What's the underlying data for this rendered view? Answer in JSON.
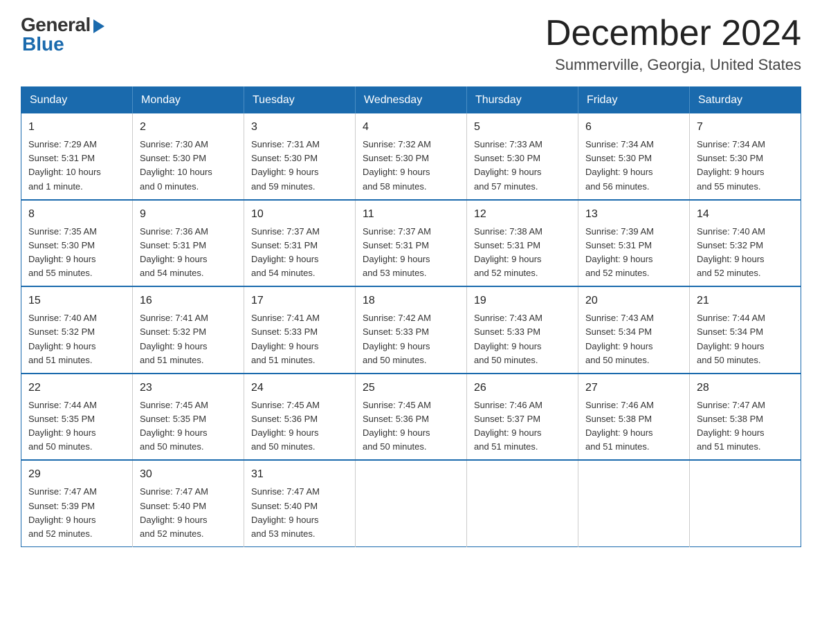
{
  "logo": {
    "general": "General",
    "blue": "Blue"
  },
  "title": "December 2024",
  "location": "Summerville, Georgia, United States",
  "days_of_week": [
    "Sunday",
    "Monday",
    "Tuesday",
    "Wednesday",
    "Thursday",
    "Friday",
    "Saturday"
  ],
  "weeks": [
    [
      {
        "day": "1",
        "info": "Sunrise: 7:29 AM\nSunset: 5:31 PM\nDaylight: 10 hours\nand 1 minute."
      },
      {
        "day": "2",
        "info": "Sunrise: 7:30 AM\nSunset: 5:30 PM\nDaylight: 10 hours\nand 0 minutes."
      },
      {
        "day": "3",
        "info": "Sunrise: 7:31 AM\nSunset: 5:30 PM\nDaylight: 9 hours\nand 59 minutes."
      },
      {
        "day": "4",
        "info": "Sunrise: 7:32 AM\nSunset: 5:30 PM\nDaylight: 9 hours\nand 58 minutes."
      },
      {
        "day": "5",
        "info": "Sunrise: 7:33 AM\nSunset: 5:30 PM\nDaylight: 9 hours\nand 57 minutes."
      },
      {
        "day": "6",
        "info": "Sunrise: 7:34 AM\nSunset: 5:30 PM\nDaylight: 9 hours\nand 56 minutes."
      },
      {
        "day": "7",
        "info": "Sunrise: 7:34 AM\nSunset: 5:30 PM\nDaylight: 9 hours\nand 55 minutes."
      }
    ],
    [
      {
        "day": "8",
        "info": "Sunrise: 7:35 AM\nSunset: 5:30 PM\nDaylight: 9 hours\nand 55 minutes."
      },
      {
        "day": "9",
        "info": "Sunrise: 7:36 AM\nSunset: 5:31 PM\nDaylight: 9 hours\nand 54 minutes."
      },
      {
        "day": "10",
        "info": "Sunrise: 7:37 AM\nSunset: 5:31 PM\nDaylight: 9 hours\nand 54 minutes."
      },
      {
        "day": "11",
        "info": "Sunrise: 7:37 AM\nSunset: 5:31 PM\nDaylight: 9 hours\nand 53 minutes."
      },
      {
        "day": "12",
        "info": "Sunrise: 7:38 AM\nSunset: 5:31 PM\nDaylight: 9 hours\nand 52 minutes."
      },
      {
        "day": "13",
        "info": "Sunrise: 7:39 AM\nSunset: 5:31 PM\nDaylight: 9 hours\nand 52 minutes."
      },
      {
        "day": "14",
        "info": "Sunrise: 7:40 AM\nSunset: 5:32 PM\nDaylight: 9 hours\nand 52 minutes."
      }
    ],
    [
      {
        "day": "15",
        "info": "Sunrise: 7:40 AM\nSunset: 5:32 PM\nDaylight: 9 hours\nand 51 minutes."
      },
      {
        "day": "16",
        "info": "Sunrise: 7:41 AM\nSunset: 5:32 PM\nDaylight: 9 hours\nand 51 minutes."
      },
      {
        "day": "17",
        "info": "Sunrise: 7:41 AM\nSunset: 5:33 PM\nDaylight: 9 hours\nand 51 minutes."
      },
      {
        "day": "18",
        "info": "Sunrise: 7:42 AM\nSunset: 5:33 PM\nDaylight: 9 hours\nand 50 minutes."
      },
      {
        "day": "19",
        "info": "Sunrise: 7:43 AM\nSunset: 5:33 PM\nDaylight: 9 hours\nand 50 minutes."
      },
      {
        "day": "20",
        "info": "Sunrise: 7:43 AM\nSunset: 5:34 PM\nDaylight: 9 hours\nand 50 minutes."
      },
      {
        "day": "21",
        "info": "Sunrise: 7:44 AM\nSunset: 5:34 PM\nDaylight: 9 hours\nand 50 minutes."
      }
    ],
    [
      {
        "day": "22",
        "info": "Sunrise: 7:44 AM\nSunset: 5:35 PM\nDaylight: 9 hours\nand 50 minutes."
      },
      {
        "day": "23",
        "info": "Sunrise: 7:45 AM\nSunset: 5:35 PM\nDaylight: 9 hours\nand 50 minutes."
      },
      {
        "day": "24",
        "info": "Sunrise: 7:45 AM\nSunset: 5:36 PM\nDaylight: 9 hours\nand 50 minutes."
      },
      {
        "day": "25",
        "info": "Sunrise: 7:45 AM\nSunset: 5:36 PM\nDaylight: 9 hours\nand 50 minutes."
      },
      {
        "day": "26",
        "info": "Sunrise: 7:46 AM\nSunset: 5:37 PM\nDaylight: 9 hours\nand 51 minutes."
      },
      {
        "day": "27",
        "info": "Sunrise: 7:46 AM\nSunset: 5:38 PM\nDaylight: 9 hours\nand 51 minutes."
      },
      {
        "day": "28",
        "info": "Sunrise: 7:47 AM\nSunset: 5:38 PM\nDaylight: 9 hours\nand 51 minutes."
      }
    ],
    [
      {
        "day": "29",
        "info": "Sunrise: 7:47 AM\nSunset: 5:39 PM\nDaylight: 9 hours\nand 52 minutes."
      },
      {
        "day": "30",
        "info": "Sunrise: 7:47 AM\nSunset: 5:40 PM\nDaylight: 9 hours\nand 52 minutes."
      },
      {
        "day": "31",
        "info": "Sunrise: 7:47 AM\nSunset: 5:40 PM\nDaylight: 9 hours\nand 53 minutes."
      },
      {
        "day": "",
        "info": ""
      },
      {
        "day": "",
        "info": ""
      },
      {
        "day": "",
        "info": ""
      },
      {
        "day": "",
        "info": ""
      }
    ]
  ]
}
